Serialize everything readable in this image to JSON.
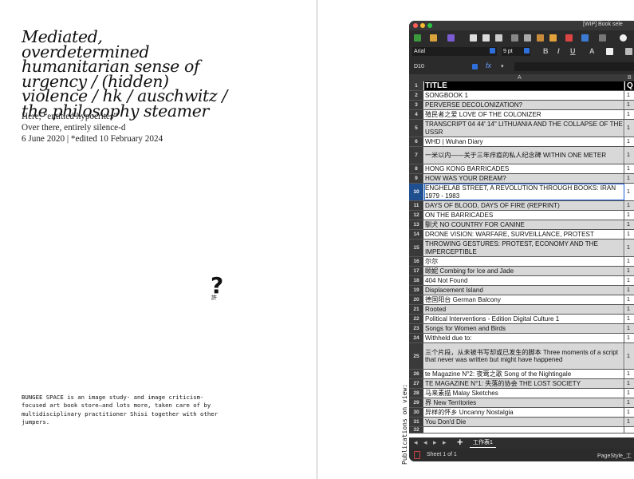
{
  "article": {
    "title": "Mediated, overdetermined humanitarian sense of urgency / (hidden) violence / hk / auschwitz / the philosophy steamer",
    "subtitle": "Here, “entitled hypocrites”",
    "subtitle2": "Over there, entirely silence-d",
    "date": "6 June 2020 | *edited 10 February 2024",
    "question_mark": "?",
    "question_small": "許",
    "about": "BUNGEE SPACE is an image study- and image criticism-focused art book store—and lots more, taken care of by multidisciplinary practitioner Shisi together with other jumpers.",
    "vertical_label": "Publications on view:"
  },
  "spreadsheet": {
    "window_title": "[WIP] Book sele",
    "font_name": "Arial",
    "font_size": "9 pt",
    "cell_ref": "D10",
    "fx": "fx",
    "col_a": "A",
    "col_b": "B",
    "sheet_tab": "工作表1",
    "sheet_status": "Sheet 1 of 1",
    "page_style": "PageStyle_工",
    "rows": [
      {
        "n": "1",
        "title": "TITLE",
        "b": "Q"
      },
      {
        "n": "2",
        "title": "SONGBOOK 1",
        "b": "1"
      },
      {
        "n": "3",
        "title": "PERVERSE DECOLONIZATION?",
        "b": "1"
      },
      {
        "n": "4",
        "title": "殖民者之爱  LOVE OF THE COLONIZER",
        "b": "1"
      },
      {
        "n": "5",
        "title": "TRANSCRIPT 04 44' 14\" LITHUANIA AND THE COLLAPSE OF THE USSR",
        "b": "1"
      },
      {
        "n": "6",
        "title": "WHD | Wuhan Diary",
        "b": "1"
      },
      {
        "n": "7",
        "title": "一米以内——关于三年疖疫的私人纪念碑 WITHIN ONE METER",
        "b": "1"
      },
      {
        "n": "8",
        "title": "HONG KONG BARRICADES",
        "b": "1"
      },
      {
        "n": "9",
        "title": "HOW WAS YOUR DREAM?",
        "b": "1"
      },
      {
        "n": "10",
        "title": "ENGHELAB STREET, A REVOLUTION THROUGH BOOKS: IRAN 1979 - 1983",
        "b": "1"
      },
      {
        "n": "11",
        "title": "DAYS OF BLOOD, DAYS OF FIRE (REPRINT)",
        "b": "1"
      },
      {
        "n": "12",
        "title": "ON THE BARRICADES",
        "b": "1"
      },
      {
        "n": "13",
        "title": "馴犬  NO COUNTRY FOR CANINE",
        "b": "1"
      },
      {
        "n": "14",
        "title": "DRONE VISION: WARFARE, SURVEILLANCE, PROTEST",
        "b": "1"
      },
      {
        "n": "15",
        "title": "THROWING GESTURES: PROTEST, ECONOMY AND THE IMPERCEPTIBLE",
        "b": "1"
      },
      {
        "n": "16",
        "title": "尔尔",
        "b": "1"
      },
      {
        "n": "17",
        "title": "颐妮  Combing for Ice and Jade",
        "b": "1"
      },
      {
        "n": "18",
        "title": "404 Not Found",
        "b": "1"
      },
      {
        "n": "19",
        "title": "Displacement Island",
        "b": "1"
      },
      {
        "n": "20",
        "title": "德国阳台  German Balcony",
        "b": "1"
      },
      {
        "n": "21",
        "title": "Rooted",
        "b": "1"
      },
      {
        "n": "22",
        "title": "Political Interventions - Edition Digital Culture 1",
        "b": "1"
      },
      {
        "n": "23",
        "title": "Songs for Women and Birds",
        "b": "1"
      },
      {
        "n": "24",
        "title": "Withheld due to:",
        "b": "1"
      },
      {
        "n": "25",
        "title": "三个片段，从未被书写却或已发生的脚本 Three moments of a script that never was written but might have happened",
        "b": "1"
      },
      {
        "n": "26",
        "title": "te Magazine N°2: 夜莺之歌 Song of the Nightingale",
        "b": "1"
      },
      {
        "n": "27",
        "title": "TE MAGAZINE N°1: 失落的协会 THE LOST SOCIETY",
        "b": "1"
      },
      {
        "n": "28",
        "title": "马来素描  Malay Sketches",
        "b": "1"
      },
      {
        "n": "29",
        "title": "界  New Territories",
        "b": "1"
      },
      {
        "n": "30",
        "title": "异样的怀乡  Uncanny Nostalgia",
        "b": "1"
      },
      {
        "n": "31",
        "title": "You Don'd Die",
        "b": "1"
      },
      {
        "n": "32",
        "title": "",
        "b": ""
      }
    ]
  }
}
